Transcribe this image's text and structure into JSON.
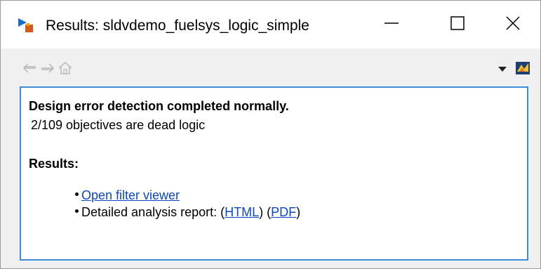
{
  "window": {
    "title": "Results: sldvdemo_fuelsys_logic_simple",
    "app_icon": "simulink-play-icon",
    "controls": {
      "minimize_icon": "minimize-icon",
      "maximize_icon": "maximize-icon",
      "close_icon": "close-icon"
    }
  },
  "toolbar": {
    "back_icon": "back-arrow-icon",
    "forward_icon": "forward-arrow-icon",
    "home_icon": "home-icon",
    "dropdown_icon": "dropdown-triangle-icon",
    "matlab_icon": "matlab-logo-icon"
  },
  "content": {
    "heading": "Design error detection completed normally.",
    "summary": "2/109 objectives are dead logic",
    "results_heading": "Results:",
    "items": {
      "open_filter_viewer": "Open filter viewer",
      "report_prefix": "Detailed analysis report: (",
      "html_link": "HTML",
      "middle": ") (",
      "pdf_link": "PDF",
      "suffix": ")"
    }
  },
  "colors": {
    "link": "#0b47c9",
    "content_border": "#3c8cd9",
    "window_background": "#f0f0f0"
  }
}
